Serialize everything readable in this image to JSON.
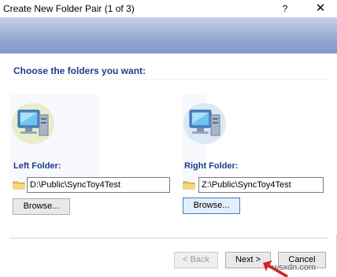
{
  "window": {
    "title": "Create New Folder Pair (1 of 3)",
    "help_label": "?",
    "close_label": "✕"
  },
  "page": {
    "heading": "Choose the folders you want:"
  },
  "left": {
    "label": "Left Folder:",
    "path": "D:\\Public\\SyncToy4Test",
    "browse_label": "Browse..."
  },
  "right": {
    "label": "Right Folder:",
    "path": "Z:\\Public\\SyncToy4Test",
    "browse_label": "Browse..."
  },
  "footer": {
    "back_label": "< Back",
    "next_label": "Next >",
    "cancel_label": "Cancel"
  },
  "watermark": "wsxdn.com",
  "colors": {
    "accent": "#1f3c88",
    "banner_top": "#c9d3e8",
    "banner_bottom": "#8398c9",
    "pointer": "#d42020"
  },
  "icons": {
    "computer": "computer-icon",
    "folder": "folder-icon",
    "pointer": "arrow-pointer-icon"
  }
}
